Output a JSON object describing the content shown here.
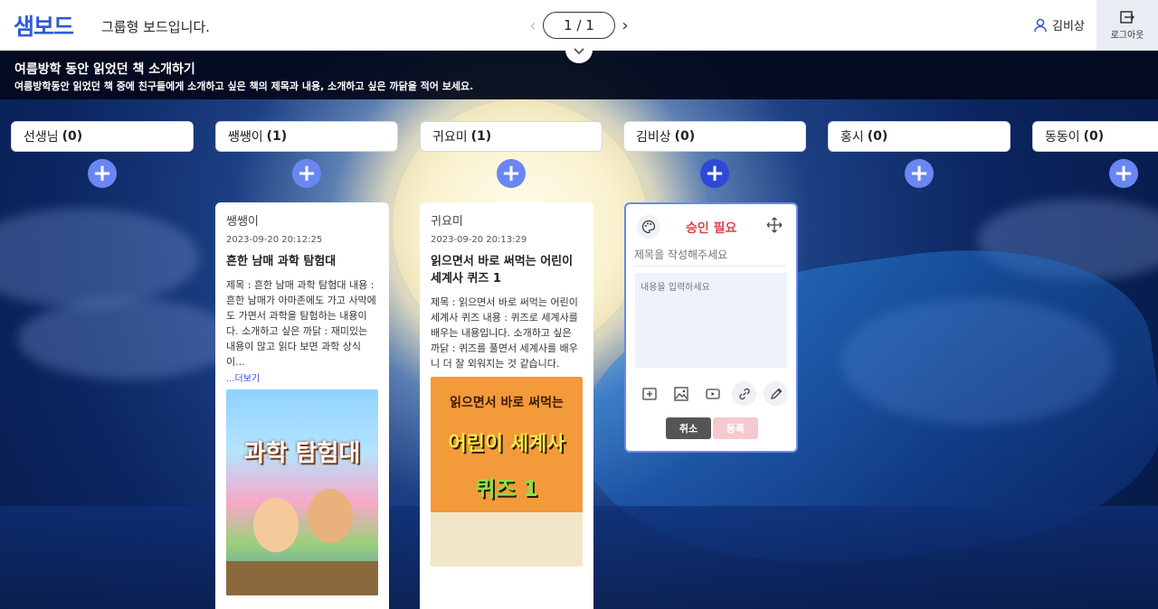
{
  "header": {
    "logo": "샘보드",
    "board_type": "그룹형 보드입니다.",
    "page_indicator": "1 / 1",
    "user_name": "김비상",
    "logout_label": "로그아웃"
  },
  "banner": {
    "title": "여름방학 동안 읽었던 책 소개하기",
    "description": "여름방학동안 읽었던 책 중에 친구들에게 소개하고 싶은 책의 제목과 내용, 소개하고 싶은 까닭을 적어 보세요."
  },
  "columns": [
    {
      "name": "선생님",
      "count": "(0)"
    },
    {
      "name": "쌩쌩이",
      "count": "(1)"
    },
    {
      "name": "귀요미",
      "count": "(1)"
    },
    {
      "name": "김비상",
      "count": "(0)"
    },
    {
      "name": "홍시",
      "count": "(0)"
    },
    {
      "name": "동동이",
      "count": "(0)"
    }
  ],
  "cards": [
    {
      "author": "쌩쌩이",
      "time": "2023-09-20 20:12:25",
      "title": "흔한 남매 과학 탐험대",
      "body": "제목 : 흔한 남매 과학 탐험대 내용 : 흔한 남매가 아마존에도 가고 사막에도 가면서 과학을 탐험하는 내용이다. 소개하고 싶은 까닭 : 재미있는 내용이 많고 읽다 보면 과학 상식이...",
      "more_label": "...더보기",
      "cover_text": "과학 탐험대"
    },
    {
      "author": "귀요미",
      "time": "2023-09-20 20:13:29",
      "title": "읽으면서 바로 써먹는 어린이 세계사 퀴즈 1",
      "body": "제목 : 읽으면서 바로 써먹는 어린이 세계사 퀴즈 내용 : 퀴즈로 세계사를 배우는 내용입니다. 소개하고 싶은 까닭 : 퀴즈를 풀면서 세계사를 배우니 더 잘 외워지는 것 같습니다.",
      "cover_text_1": "읽으면서 바로 써먹는",
      "cover_text_2": "어린이 세계사",
      "cover_text_3": "퀴즈 1"
    }
  ],
  "editor": {
    "status": "승인 필요",
    "title_placeholder": "제목을 작성해주세요",
    "body_placeholder": "내용을 입력하세요",
    "cancel_label": "취소",
    "submit_label": "등록"
  },
  "colors": {
    "brand": "#2f5ad8",
    "add_button": "#6a86f2",
    "approval": "#e0434a"
  }
}
